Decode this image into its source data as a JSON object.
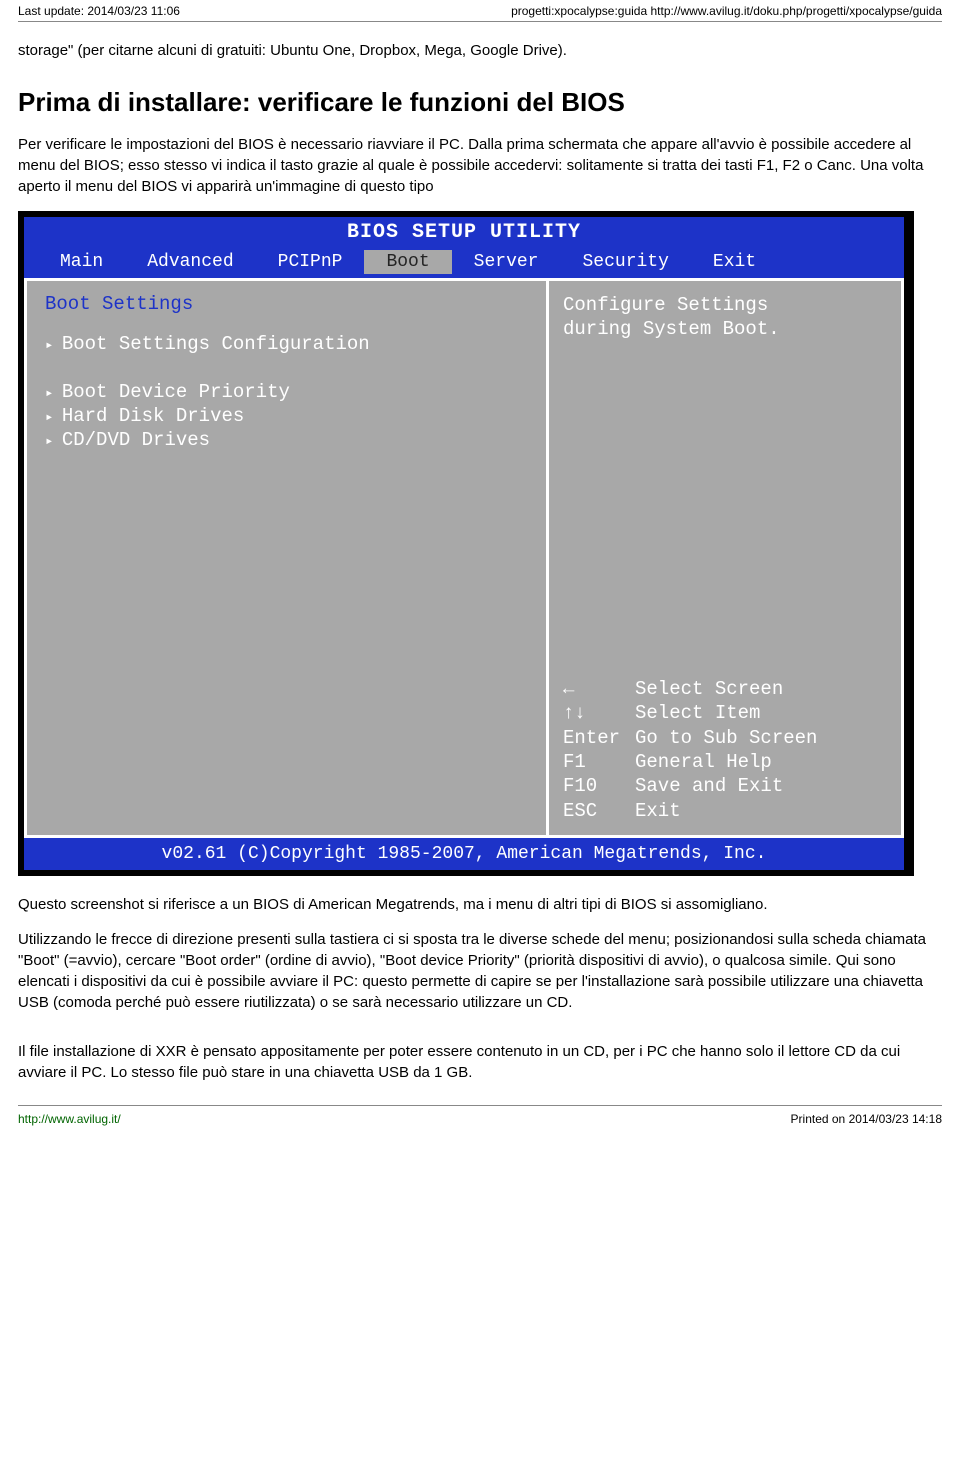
{
  "header": {
    "left": "Last update: 2014/03/23 11:06",
    "right": "progetti:xpocalypse:guida http://www.avilug.it/doku.php/progetti/xpocalypse/guida"
  },
  "para_top": "storage\" (per citarne alcuni di gratuiti: Ubuntu One, Dropbox, Mega, Google Drive).",
  "section_title": "Prima di installare: verificare le funzioni del BIOS",
  "para_intro": "Per verificare le impostazioni del BIOS è necessario riavviare il PC. Dalla prima schermata che appare all'avvio è possibile accedere al menu del BIOS; esso stesso vi indica il tasto grazie al quale è possibile accedervi: solitamente si tratta dei tasti F1, F2 o Canc. Una volta aperto il menu del BIOS vi apparirà un'immagine di questo tipo",
  "bios": {
    "title": "BIOS SETUP UTILITY",
    "tabs": [
      "Main",
      "Advanced",
      "PCIPnP",
      "Boot",
      "Server",
      "Security",
      "Exit"
    ],
    "selected_tab_index": 3,
    "left_heading": "Boot Settings",
    "group1": [
      "Boot Settings Configuration"
    ],
    "group2": [
      "Boot Device Priority",
      "Hard Disk Drives",
      "CD/DVD Drives"
    ],
    "right_desc_1": "Configure Settings",
    "right_desc_2": "during System Boot.",
    "help": [
      {
        "key": "←",
        "label": "Select Screen"
      },
      {
        "key": "↑↓",
        "label": "Select Item"
      },
      {
        "key": "Enter",
        "label": "Go to Sub Screen"
      },
      {
        "key": "F1",
        "label": "General Help"
      },
      {
        "key": "F10",
        "label": "Save and Exit"
      },
      {
        "key": "ESC",
        "label": "Exit"
      }
    ],
    "footer": "v02.61 (C)Copyright 1985-2007, American Megatrends, Inc."
  },
  "para_after_1": "Questo screenshot si riferisce a un BIOS di American Megatrends, ma i menu di altri tipi di BIOS si assomigliano.",
  "para_after_2": "Utilizzando le frecce di direzione presenti sulla tastiera ci si sposta tra le diverse schede del menu; posizionandosi sulla scheda chiamata \"Boot\" (=avvio), cercare \"Boot order\" (ordine di avvio), \"Boot device Priority\" (priorità dispositivi di avvio), o qualcosa simile. Qui sono elencati i dispositivi da cui è possibile avviare il PC: questo permette di capire se per l'installazione sarà possibile utilizzare una chiavetta USB (comoda perché può essere riutilizzata) o se sarà necessario utilizzare un CD.",
  "para_after_3": "Il file installazione di XXR è pensato appositamente per poter essere contenuto in un CD, per i PC che hanno solo il lettore CD da cui avviare il PC. Lo stesso file può stare in una chiavetta USB da 1 GB.",
  "footer": {
    "left": "http://www.avilug.it/",
    "right": "Printed on 2014/03/23 14:18"
  }
}
